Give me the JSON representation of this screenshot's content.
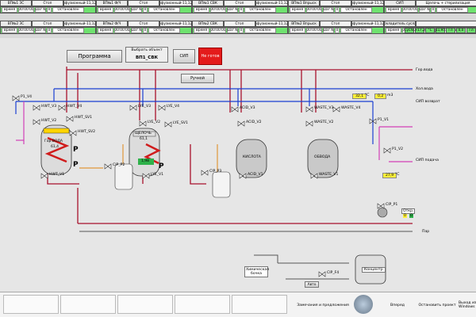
{
  "header_row": [
    {
      "id": "ВПВ",
      "txt": "ВП№1 ЗС",
      "stage": "Стоп",
      "prog": "Инфузионный-11,12%",
      "state": "Стоп"
    },
    {
      "id": "ВП2",
      "txt": "ВП№1 Ф/Ч",
      "stage": "Стоп",
      "prog": "Инфузионный-11,12%",
      "state": "Стоп"
    },
    {
      "id": "ВП3",
      "txt": "ВП№1 СВК",
      "stage": "Стоп",
      "prog": "Инфузионный-11,12%",
      "state": "Стоп"
    },
    {
      "id": "ВП4",
      "txt": "ВП№1 Впрыск",
      "stage": "Стоп",
      "prog": "Инфузионный-11,12%",
      "state": "Стоп"
    },
    {
      "id": "СИП",
      "txt": "СИП",
      "stage": "Щелочь + стерилизация",
      "state": "Промывка"
    }
  ],
  "status_row": {
    "ver": "0",
    "rm": "Остановлен",
    "t1": "Время",
    "t2": "00:00:00",
    "shag": "Шаг №",
    "zero": "0",
    "ostan": "Остановлен"
  },
  "second_header": [
    {
      "txt": "ВП№2 ЗС",
      "stage": "Стоп",
      "prog": "Инфузионный-11,12%",
      "state": "Стоп"
    },
    {
      "txt": "ВП№2 Ф/Ч",
      "stage": "Стоп",
      "prog": "Инфузионный-11,12%",
      "state": "Стоп"
    },
    {
      "txt": "ВП№2 СВК",
      "stage": "Стоп",
      "prog": "Инфузионный-11,12%",
      "state": "Стоп"
    },
    {
      "txt": "ВП№2 Впрыск",
      "stage": "Стоп",
      "prog": "Инфузионный-11,12%",
      "state": "Стоп"
    },
    {
      "txt": "Охладитель сусла",
      "state": ""
    }
  ],
  "second_status": {
    "a": "00:00:00",
    "b": "Остановлен",
    "c": "Время",
    "d": "00:00:00",
    "e": "Шаг №",
    "f": "0",
    "g": "Остановлен",
    "h": "Сусло",
    "i": "+17,2",
    "j": "°C",
    "k": "11,95",
    "l": "Гл",
    "m": "0,0",
    "n": "Гл"
  },
  "toolbar": {
    "program_button": "Программа",
    "select_object_label": "Выбрать объект",
    "selected_object": "ВП1_СВК",
    "cip_label": "СИП",
    "not_ready": "Не готов",
    "manual_button": "Ручной"
  },
  "diagram": {
    "tanks": [
      {
        "name": "Гор.ВОДА",
        "sub": "61,4"
      },
      {
        "name": "ЩЕЛОЧЬ",
        "sub": "61,1"
      },
      {
        "name": "КИСЛОТА",
        "sub": ""
      },
      {
        "name": "ОБВОДА",
        "sub": ""
      }
    ],
    "valves": [
      "P1_V4",
      "HWT_V3",
      "HWT_V4",
      "HWT_V2",
      "HWT_SV1",
      "HWT_SV2",
      "HWT_V1",
      "LYE_V3",
      "LYE_V4",
      "LYE_V2",
      "LYE_SV1",
      "LYE_V1",
      "ACID_V3",
      "ACID_V2",
      "ACID_V1",
      "WASTE_V3",
      "WASTE_V4",
      "WASTE_V2",
      "WASTE_V1",
      "P1_V1",
      "P1_V2",
      "CIP_P1",
      "CIP_P2",
      "CIP_F4",
      "CIP_P3"
    ],
    "lines": [
      "Гор.вода",
      "Хол.вода",
      "СИП возврат",
      "СИП подача",
      "Пар"
    ],
    "readings": [
      "32,1",
      "°C",
      "0,2",
      "m3"
    ],
    "pump_readings": [
      "Откр.",
      "0",
      "0"
    ],
    "lye_conc": "1,98",
    "bottom_labels": [
      "Химическая бочка",
      "Концентр",
      "Авто",
      "Подача"
    ],
    "right_values": [
      "27,9",
      "°C"
    ]
  },
  "footer": {
    "remarks_button": "Замечания и предложения",
    "back_button": "Вперед",
    "stop_project_button": "Остановить проект",
    "exit_button": "Выход из Windows"
  },
  "colors": {
    "hot": "#b0002a",
    "steam": "#333",
    "blue": "#1a3fd1",
    "pink": "#d23fb7",
    "orange": "#e0963a",
    "green": "#2fb24b"
  }
}
